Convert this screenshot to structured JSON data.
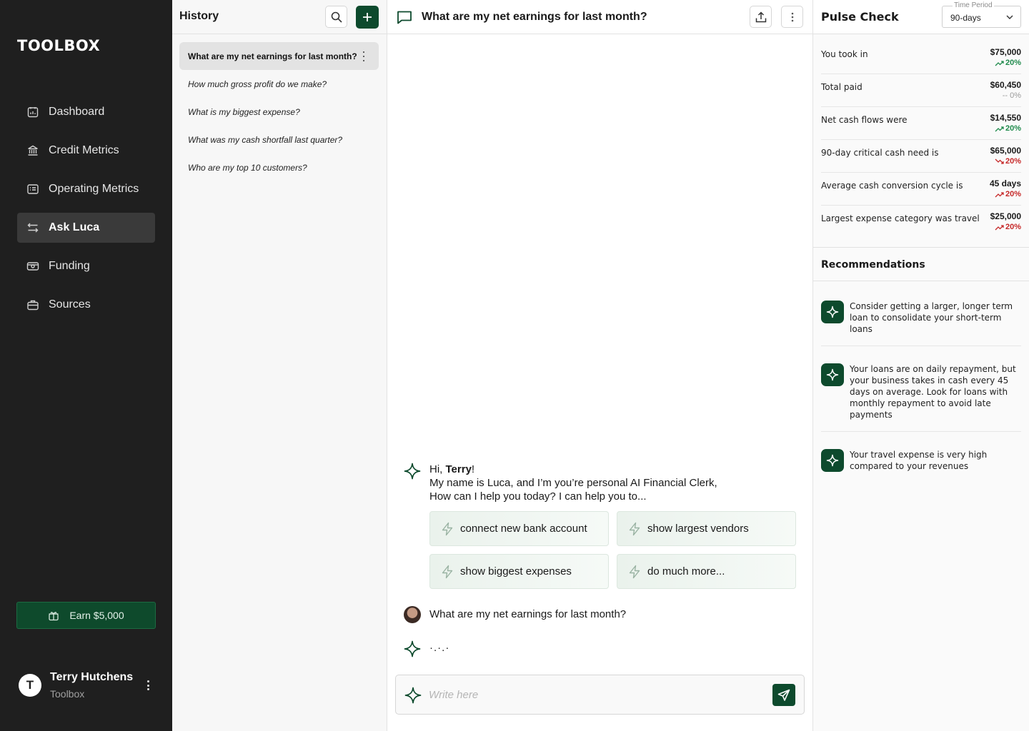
{
  "app": {
    "logo": "TOOLBOX"
  },
  "sidebar": {
    "items": [
      {
        "label": "Dashboard",
        "icon": "dashboard-icon"
      },
      {
        "label": "Credit Metrics",
        "icon": "bank-icon"
      },
      {
        "label": "Operating Metrics",
        "icon": "list-icon"
      },
      {
        "label": "Ask Luca",
        "icon": "swap-arrows-icon",
        "active": true
      },
      {
        "label": "Funding",
        "icon": "cash-icon"
      },
      {
        "label": "Sources",
        "icon": "briefcase-icon"
      }
    ],
    "earn_label": "Earn $5,000",
    "user": {
      "initial": "T",
      "name": "Terry Hutchens",
      "org": "Toolbox"
    }
  },
  "history": {
    "title": "History",
    "items": [
      "What are my net earnings for last month?",
      "How much gross profit do we make?",
      "What is my biggest expense?",
      "What was my cash shortfall last quarter?",
      "Who are my top 10 customers?"
    ]
  },
  "chat": {
    "title": "What are my net earnings for last month?",
    "greeting": {
      "hi": "Hi, ",
      "name": "Terry",
      "excl": "!",
      "line2": "My name is Luca, and I’m you’re personal AI Financial Clerk,",
      "line3": "How can I help you today? I can help you to..."
    },
    "suggestions": [
      "connect new bank account",
      "show largest vendors",
      "show biggest expenses",
      "do much more..."
    ],
    "user_message": "What are my net earnings for last month?",
    "typing": "·.·.·",
    "input_placeholder": "Write here"
  },
  "pulse": {
    "title": "Pulse Check",
    "period_label": "Time Period",
    "period_value": "90-days",
    "metrics": [
      {
        "label": "You took in",
        "value": "$75,000",
        "change": "20%",
        "trend": "up"
      },
      {
        "label": "Total paid",
        "value": "$60,450",
        "change": "-- 0%",
        "trend": "flat"
      },
      {
        "label": "Net cash flows were",
        "value": "$14,550",
        "change": "20%",
        "trend": "up"
      },
      {
        "label": "90-day critical cash need is",
        "value": "$65,000",
        "change": "20%",
        "trend": "down"
      },
      {
        "label": "Average cash conversion cycle is",
        "value": "45 days",
        "change": "20%",
        "trend": "up-red"
      },
      {
        "label": "Largest expense category was travel",
        "value": "$25,000",
        "change": "20%",
        "trend": "up-red"
      }
    ],
    "recommendations_title": "Recommendations",
    "recommendations": [
      "Consider getting a larger, longer term loan to consolidate your short-term loans",
      "Your loans are on daily repayment, but your business takes in cash every 45 days on average. Look for loans with monthly repayment to avoid late payments",
      "Your travel expense is very high compared to your revenues"
    ]
  },
  "colors": {
    "brand_green": "#0d4a2d",
    "sidebar_bg": "#1f1f1f",
    "positive": "#1f8a4c",
    "negative": "#c62828"
  }
}
